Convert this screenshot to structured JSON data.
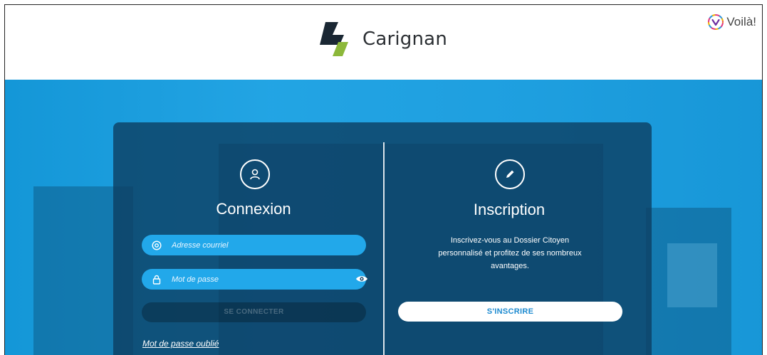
{
  "header": {
    "brand_name": "Carignan",
    "partner_name": "Voilà!"
  },
  "login": {
    "title": "Connexion",
    "email_placeholder": "Adresse courriel",
    "password_placeholder": "Mot de passe",
    "submit_label": "SE CONNECTER",
    "forgot_link": "Mot de passe oublié"
  },
  "register": {
    "title": "Inscription",
    "description_lines": [
      "Inscrivez-vous au Dossier Citoyen",
      "personnalisé et profitez de ses nombreux",
      "avantages."
    ],
    "button_label": "S'INSCRIRE"
  },
  "colors": {
    "brand_dark": "#1a2733",
    "brand_green": "#8cb83a",
    "accent_blue": "#22a8ea",
    "panel": "#0c3e62"
  },
  "icons": {
    "user": "user-icon",
    "pencil": "pencil-icon",
    "email": "at-icon",
    "lock": "lock-icon",
    "eye": "eye-icon"
  }
}
